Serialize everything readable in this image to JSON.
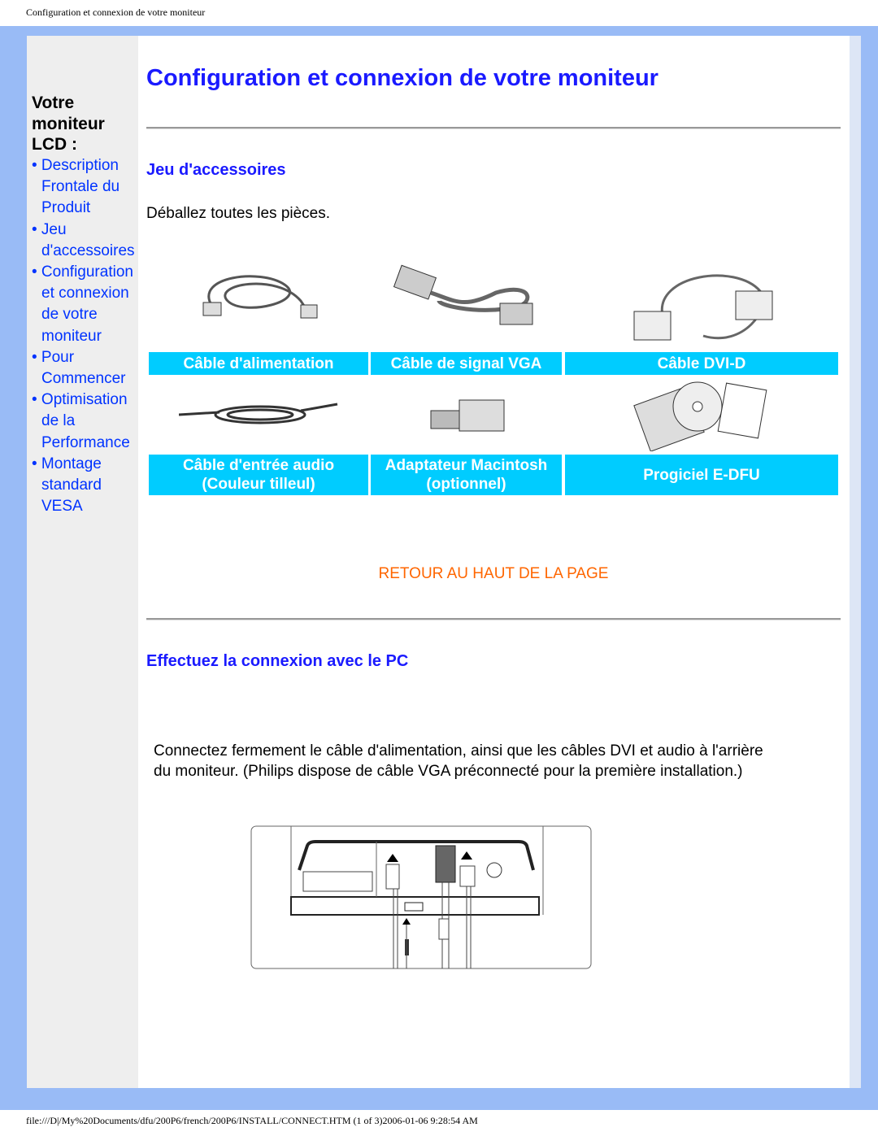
{
  "header": {
    "title": "Configuration et connexion de votre moniteur"
  },
  "footer": {
    "text": "file:///D|/My%20Documents/dfu/200P6/french/200P6/INSTALL/CONNECT.HTM (1 of 3)2006-01-06 9:28:54 AM"
  },
  "sidebar": {
    "heading": "Votre moniteur LCD :",
    "items": [
      {
        "label": "• Description Frontale du Produit"
      },
      {
        "label": "• Jeu d'accessoires"
      },
      {
        "label": "• Configuration et connexion de votre moniteur"
      },
      {
        "label": "• Pour Commencer"
      },
      {
        "label": "• Optimisation de la Performance"
      },
      {
        "label": "• Montage standard VESA"
      }
    ]
  },
  "main": {
    "title": "Configuration et connexion de votre moniteur",
    "section1": {
      "heading": "Jeu d'accessoires",
      "intro": "Déballez toutes les pièces.",
      "items": [
        {
          "label": "Câble d'alimentation",
          "icon": "power-cable-image"
        },
        {
          "label": "Câble de signal VGA",
          "icon": "vga-cable-image"
        },
        {
          "label": "Câble DVI-D",
          "icon": "dvi-cable-image"
        },
        {
          "label_line1": "Câble d'entrée audio",
          "label_line2": "(Couleur tilleul)",
          "icon": "audio-cable-image"
        },
        {
          "label_line1": "Adaptateur Macintosh",
          "label_line2": "(optionnel)",
          "icon": "mac-adapter-image"
        },
        {
          "label": "Progiciel E-DFU",
          "icon": "cd-and-guide-image"
        }
      ]
    },
    "back_to_top": "RETOUR AU HAUT DE LA PAGE",
    "section2": {
      "heading": "Effectuez la connexion avec le PC",
      "text": "Connectez fermement le câble d'alimentation, ainsi que les câbles DVI et audio à l'arrière du moniteur. (Philips dispose de câble VGA préconnecté pour la première installation.)"
    }
  },
  "colors": {
    "frame": "#99bbf6",
    "label_bg": "#00ccff",
    "title": "#1a1aff",
    "link": "#0033ff",
    "back_link": "#ff6600"
  }
}
